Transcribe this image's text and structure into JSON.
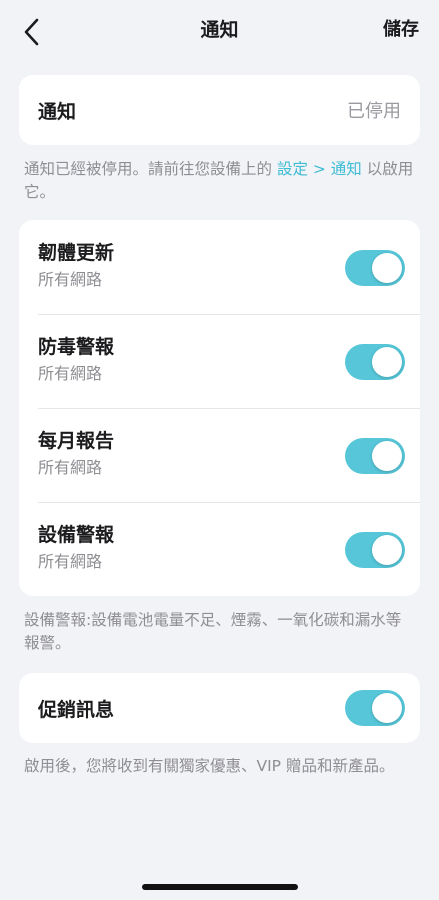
{
  "nav": {
    "title": "通知",
    "save_label": "儲存"
  },
  "notification_card": {
    "label": "通知",
    "status": "已停用"
  },
  "disabled_note": {
    "prefix": "通知已經被停用。請前往您設備上的 ",
    "link": "設定 > 通知",
    "suffix": " 以啟用它。"
  },
  "alerts": [
    {
      "title": "韌體更新",
      "subtitle": "所有網路",
      "enabled": true
    },
    {
      "title": "防毒警報",
      "subtitle": "所有網路",
      "enabled": true
    },
    {
      "title": "每月報告",
      "subtitle": "所有網路",
      "enabled": true
    },
    {
      "title": "設備警報",
      "subtitle": "所有網路",
      "enabled": true
    }
  ],
  "device_alert_note": "設備警報:設備電池電量不足、煙霧、一氧化碳和漏水等報警。",
  "promo": {
    "label": "促銷訊息",
    "enabled": true,
    "note": "啟用後，您將收到有關獨家優惠、VIP 贈品和新產品。"
  },
  "colors": {
    "accent": "#56c6d8",
    "link": "#3dbcd3",
    "background": "#f2f3f7"
  },
  "icons": {
    "back": "chevron-left-icon"
  }
}
